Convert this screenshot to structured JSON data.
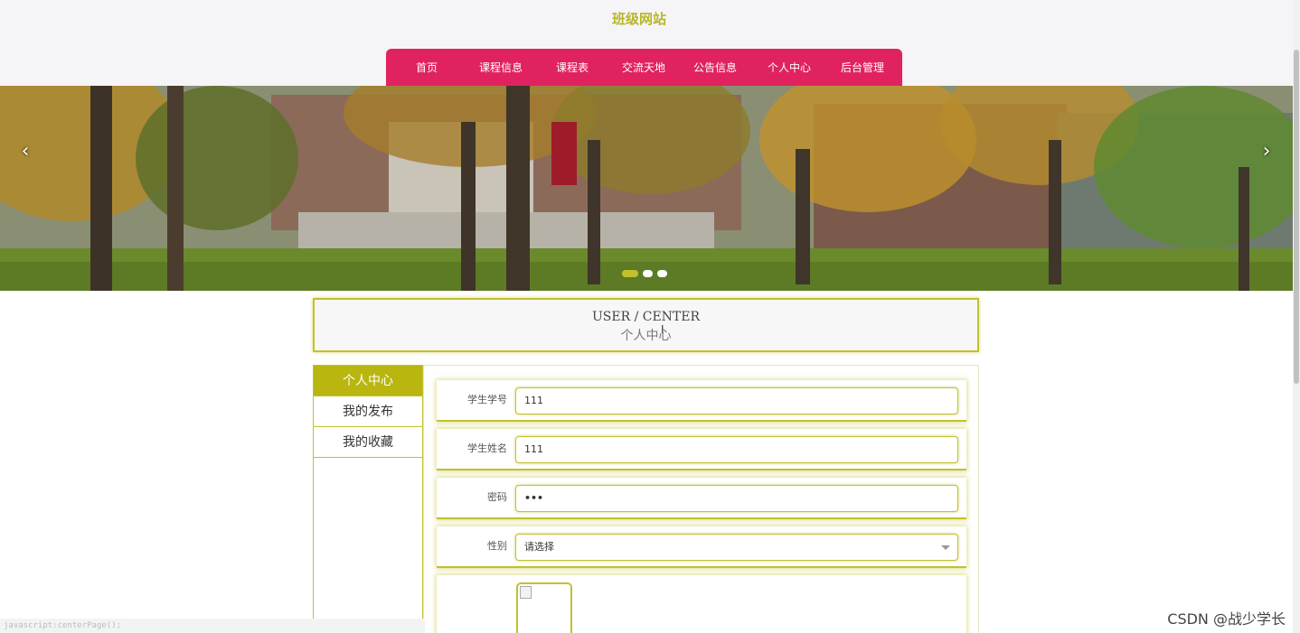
{
  "header": {
    "site_title": "班级网站",
    "nav": [
      "首页",
      "课程信息",
      "课程表",
      "交流天地",
      "公告信息",
      "个人中心",
      "后台管理"
    ],
    "nav_color": "#e0235e"
  },
  "banner": {
    "prev_arrow": "‹",
    "next_arrow": "›",
    "slides": 3,
    "active_slide": 1
  },
  "center_title": {
    "en": "USER / CENTER",
    "cn": "个人中心"
  },
  "side_menu": {
    "items": [
      "个人中心",
      "我的发布",
      "我的收藏"
    ],
    "active": "个人中心"
  },
  "form": {
    "fields": [
      {
        "label": "学生学号",
        "value": "111"
      },
      {
        "label": "学生姓名",
        "value": "111"
      },
      {
        "label": "密码",
        "value": "•••"
      },
      {
        "label": "性别",
        "value": "请选择"
      }
    ]
  },
  "status_bar": "javascript:centerPage();",
  "watermark": "CSDN @战少学长",
  "colors": {
    "accent": "#c2c12d",
    "nav": "#e0235e",
    "side_active": "#b8b60f"
  }
}
